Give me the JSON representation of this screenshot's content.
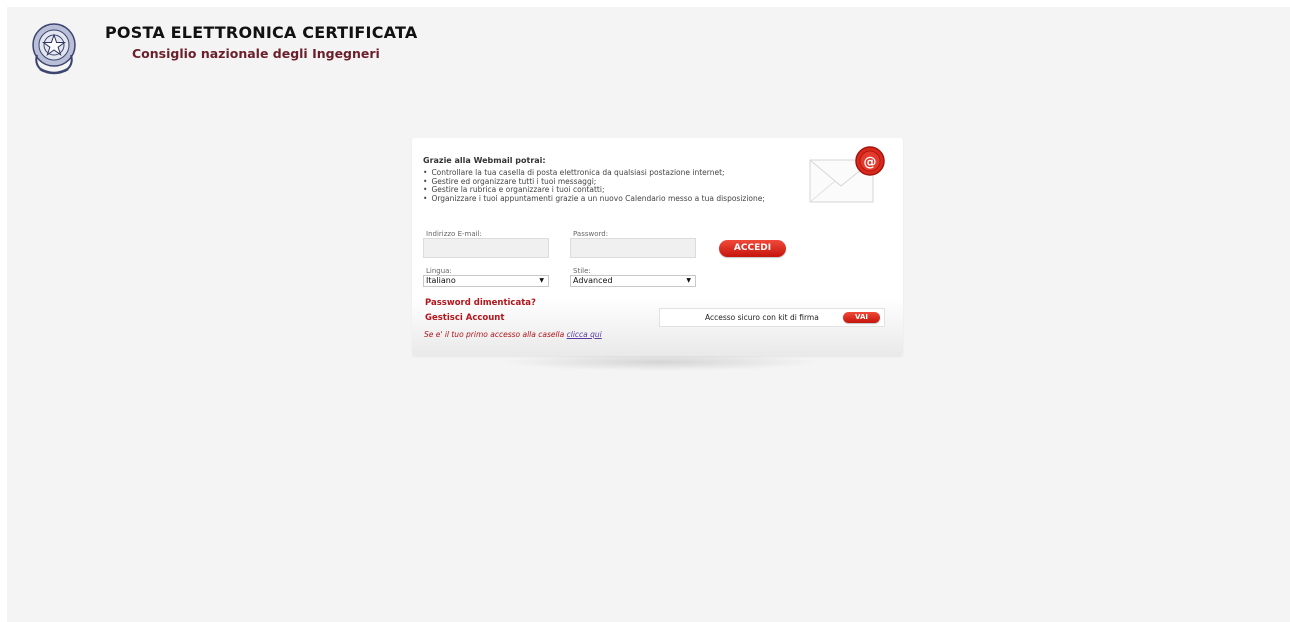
{
  "header": {
    "title": "POSTA ELETTRONICA CERTIFICATA",
    "subtitle": "Consiglio nazionale degli Ingegneri"
  },
  "intro": {
    "title": "Grazie alla Webmail potrai:",
    "features": [
      "Controllare la tua casella di posta elettronica da qualsiasi postazione internet;",
      "Gestire ed organizzare tutti i tuoi messaggi;",
      "Gestire la rubrica e organizzare i tuoi contatti;",
      "Organizzare i tuoi appuntamenti grazie a un nuovo Calendario messo a tua disposizione;"
    ]
  },
  "login": {
    "email_label": "Indirizzo E-mail:",
    "email_value": "",
    "password_label": "Password:",
    "password_value": "",
    "submit_label": "ACCEDI"
  },
  "options": {
    "language_label": "Lingua:",
    "language_value": "Italiano",
    "style_label": "Stile:",
    "style_value": "Advanced"
  },
  "links": {
    "forgot_password": "Password dimenticata?",
    "manage_account": "Gestisci Account",
    "first_access_text": "Se e' il tuo primo accesso alla casella",
    "first_access_link": "clicca qui"
  },
  "signkit": {
    "label": "Accesso sicuro con kit di firma",
    "button_label": "VAI"
  },
  "colors": {
    "accent_red": "#c4140c",
    "brand_maroon": "#6b1f2a",
    "link_purple": "#5a3aa0",
    "background": "#f4f4f4"
  },
  "icons": {
    "emblem": "italian-republic-emblem",
    "envelope": "envelope-with-at-seal"
  }
}
